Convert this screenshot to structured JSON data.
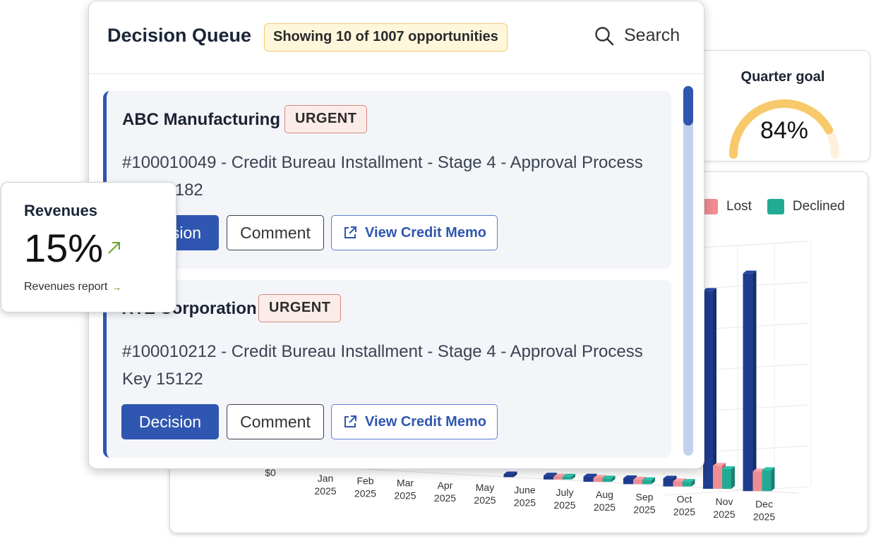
{
  "queue": {
    "title": "Decision Queue",
    "count_badge": "Showing 10 of 1007 opportunities",
    "search_label": "Search",
    "cards": [
      {
        "company": "ABC Manufacturing",
        "badge": "URGENT",
        "description": "#100010049 - Credit Bureau Installment - Stage 4 - Approval Process Key 15182",
        "decision_label": "Decision",
        "comment_label": "Comment",
        "memo_label": "View Credit Memo"
      },
      {
        "company": "XYZ Corporation",
        "badge": "URGENT",
        "description": "#100010212 - Credit Bureau Installment - Stage 4 - Approval Process Key 15122",
        "decision_label": "Decision",
        "comment_label": "Comment",
        "memo_label": "View Credit Memo"
      }
    ]
  },
  "quarter_goal": {
    "title": "Quarter goal",
    "value_label": "84%",
    "progress": 0.84
  },
  "revenues": {
    "title": "Revenues",
    "value": "15%",
    "trend": "up",
    "link_label": "Revenues report",
    "link_arrow": "→"
  },
  "colors": {
    "primary": "#2f56b0",
    "approved": "#1f3d8f",
    "lost": "#f08c92",
    "declined": "#22ab94",
    "gauge": "#f7c96a",
    "badge_bg": "#fff7dc",
    "urgent_bg": "#fbece9",
    "trend_up": "#6aa52a"
  },
  "chart_data": {
    "type": "bar",
    "series": [
      {
        "name": "Lost",
        "values": [
          0,
          0,
          0,
          0,
          0,
          0,
          4,
          6,
          7,
          8,
          35,
          30
        ]
      },
      {
        "name": "Declined",
        "values": [
          0,
          0,
          0,
          0,
          0,
          0,
          3,
          5,
          6,
          7,
          30,
          32
        ]
      },
      {
        "values": [
          0,
          0,
          0,
          0,
          0,
          3,
          6,
          8,
          9,
          12,
          300,
          330
        ]
      }
    ],
    "categories": [
      [
        "Jan",
        "2025"
      ],
      [
        "Feb",
        "2025"
      ],
      [
        "Mar",
        "2025"
      ],
      [
        "Apr",
        "2025"
      ],
      [
        "May",
        "2025"
      ],
      [
        "June",
        "2025"
      ],
      [
        "July",
        "2025"
      ],
      [
        "Aug",
        "2025"
      ],
      [
        "Sep",
        "2025"
      ],
      [
        "Oct",
        "2025"
      ],
      [
        "Nov",
        "2025"
      ],
      [
        "Dec",
        "2025"
      ]
    ],
    "y_ticks": [
      "$0"
    ],
    "legend": [
      "Lost",
      "Declined"
    ],
    "legend_position": "top-right",
    "grid": true
  }
}
